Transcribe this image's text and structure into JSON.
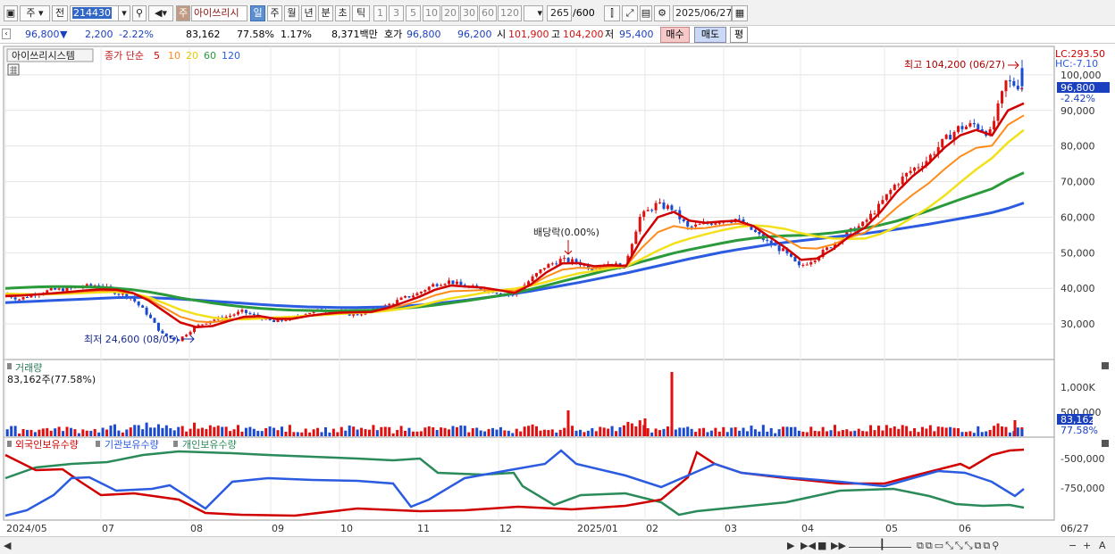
{
  "toolbar": {
    "period_weekly": "주",
    "prev_label": "전",
    "stock_code": "214430",
    "stock_tab": "주",
    "stock_name": "아이쓰리시",
    "periods": [
      "일",
      "주",
      "월",
      "년",
      "분",
      "초",
      "틱"
    ],
    "counts": [
      "1",
      "3",
      "5",
      "10",
      "20",
      "30",
      "60",
      "120"
    ],
    "bar_count": "265",
    "bar_total": "/600",
    "date": "2025/06/27"
  },
  "info": {
    "price": "96,800",
    "change_arrow": "▼",
    "change": "2,200",
    "change_pct": "-2.22%",
    "volume": "83,162",
    "vol_ratio": "77.58%",
    "turnover": "1.17%",
    "amount": "8,371백만",
    "quote_label": "호가",
    "ask": "96,800",
    "bid": "96,200",
    "open_label": "시",
    "open": "101,900",
    "high_label": "고",
    "high": "104,200",
    "low_label": "저",
    "low": "95,400",
    "buy": "매수",
    "sell": "매도",
    "eval": "평"
  },
  "legend": {
    "name": "아이쓰리시스템",
    "ma_label": "종가 단순",
    "ma": [
      "5",
      "10",
      "20",
      "60",
      "120"
    ]
  },
  "ma_colors": [
    "#d00000",
    "#ff8c1a",
    "#f2e11a",
    "#2a9a3a",
    "#2b5be0"
  ],
  "annotations": {
    "high": "최고 104,200 (06/27)",
    "low": "최저 24,600 (08/05)",
    "dividend": "배당락(0.00%)"
  },
  "y_axis": {
    "lc": "LC:293.50",
    "hc": "HC:-7.10",
    "current": "96,800",
    "current_pct": "-2.42%",
    "ticks": [
      "100,000",
      "90,000",
      "80,000",
      "70,000",
      "60,000",
      "50,000",
      "40,000",
      "30,000"
    ]
  },
  "volume_panel": {
    "title": "거래량",
    "value": "83,162주(77.58%)",
    "ticks": [
      "1,000K",
      "500,000"
    ],
    "current": "83,162",
    "current_pct": "77.58%"
  },
  "holdings_panel": {
    "foreign": "외국인보유수량",
    "institution": "기관보유수량",
    "individual": "개인보유수량",
    "ticks": [
      "-500,000",
      "-750,000"
    ],
    "colors": [
      "#d00000",
      "#2b5be0",
      "#2a8a5a"
    ]
  },
  "x_axis": {
    "labels": [
      "2024/05",
      "07",
      "08",
      "09",
      "10",
      "11",
      "12",
      "2025/01",
      "02",
      "03",
      "04",
      "05",
      "06"
    ],
    "last": "06/27"
  },
  "chart_data": {
    "type": "candlestick",
    "price_range": [
      20000,
      108000
    ],
    "closes": [
      38500,
      37000,
      38500,
      39500,
      39800,
      40500,
      41000,
      39000,
      37500,
      33000,
      27000,
      25500,
      29000,
      31000,
      32000,
      33500,
      32000,
      30500,
      31500,
      33000,
      34000,
      33500,
      32500,
      33500,
      35000,
      37000,
      38500,
      41000,
      42000,
      40500,
      40000,
      39000,
      38000,
      42000,
      46000,
      48000,
      47500,
      45500,
      47000,
      46000,
      60000,
      63500,
      62500,
      57000,
      58000,
      59000,
      59500,
      56500,
      53000,
      50500,
      46000,
      48500,
      52000,
      55500,
      58000,
      63000,
      69000,
      73000,
      76000,
      81000,
      85000,
      86000,
      83500,
      98000,
      96800
    ],
    "ma_values": {
      "5": [
        37800,
        38000,
        38300,
        38600,
        39000,
        39400,
        39700,
        39600,
        38700,
        36600,
        33500,
        30400,
        29100,
        29400,
        30800,
        32000,
        32200,
        31400,
        31400,
        32200,
        32800,
        33200,
        33300,
        33400,
        34500,
        36000,
        37600,
        39600,
        40800,
        40500,
        40200,
        39500,
        38700,
        41000,
        44500,
        47000,
        47100,
        46200,
        46500,
        46300,
        54000,
        60000,
        61500,
        59000,
        58400,
        58800,
        59000,
        57500,
        54500,
        51500,
        48000,
        48400,
        51000,
        54500,
        57000,
        61500,
        67000,
        71500,
        75000,
        79500,
        83000,
        84500,
        83000,
        90000,
        92000
      ],
      "20": [
        38500,
        38400,
        38300,
        38400,
        38500,
        38700,
        38900,
        39000,
        38600,
        37500,
        35800,
        34000,
        32700,
        31800,
        31300,
        31300,
        31500,
        31800,
        32000,
        32300,
        32500,
        32800,
        33100,
        33300,
        33700,
        34300,
        35100,
        36200,
        37200,
        37900,
        38700,
        39400,
        39900,
        40700,
        41800,
        43100,
        44200,
        44900,
        45700,
        46200,
        48300,
        50600,
        52600,
        54000,
        55200,
        56300,
        57200,
        57700,
        57400,
        56700,
        55500,
        54600,
        54000,
        53900,
        54000,
        55300,
        57300,
        59900,
        62700,
        66000,
        69800,
        73400,
        76600,
        81000,
        84500
      ],
      "60": [
        40000,
        40200,
        40400,
        40500,
        40500,
        40400,
        40300,
        40000,
        39600,
        39000,
        38200,
        37300,
        36600,
        35900,
        35300,
        34800,
        34400,
        34100,
        33900,
        33800,
        33700,
        33700,
        33800,
        33900,
        34100,
        34400,
        34800,
        35300,
        35900,
        36500,
        37200,
        37900,
        38700,
        39700,
        40800,
        42000,
        43100,
        44200,
        45300,
        46200,
        47500,
        48700,
        49900,
        50900,
        51800,
        52700,
        53500,
        54100,
        54500,
        54800,
        54900,
        55200,
        55600,
        56200,
        56900,
        57800,
        58900,
        60300,
        61800,
        63400,
        65000,
        66500,
        68000,
        70500,
        72500
      ],
      "120": [
        36000,
        36200,
        36400,
        36600,
        36800,
        37000,
        37200,
        37400,
        37500,
        37400,
        37200,
        37000,
        36700,
        36400,
        36100,
        35800,
        35500,
        35200,
        35000,
        34800,
        34700,
        34600,
        34600,
        34700,
        34800,
        35000,
        35300,
        35700,
        36200,
        36700,
        37300,
        37900,
        38500,
        39200,
        40000,
        40800,
        41600,
        42500,
        43400,
        44300,
        45300,
        46300,
        47300,
        48300,
        49200,
        50100,
        50900,
        51600,
        52300,
        52900,
        53400,
        53900,
        54400,
        54900,
        55400,
        56000,
        56600,
        57300,
        58000,
        58800,
        59600,
        60400,
        61300,
        62500,
        64000
      ]
    }
  }
}
